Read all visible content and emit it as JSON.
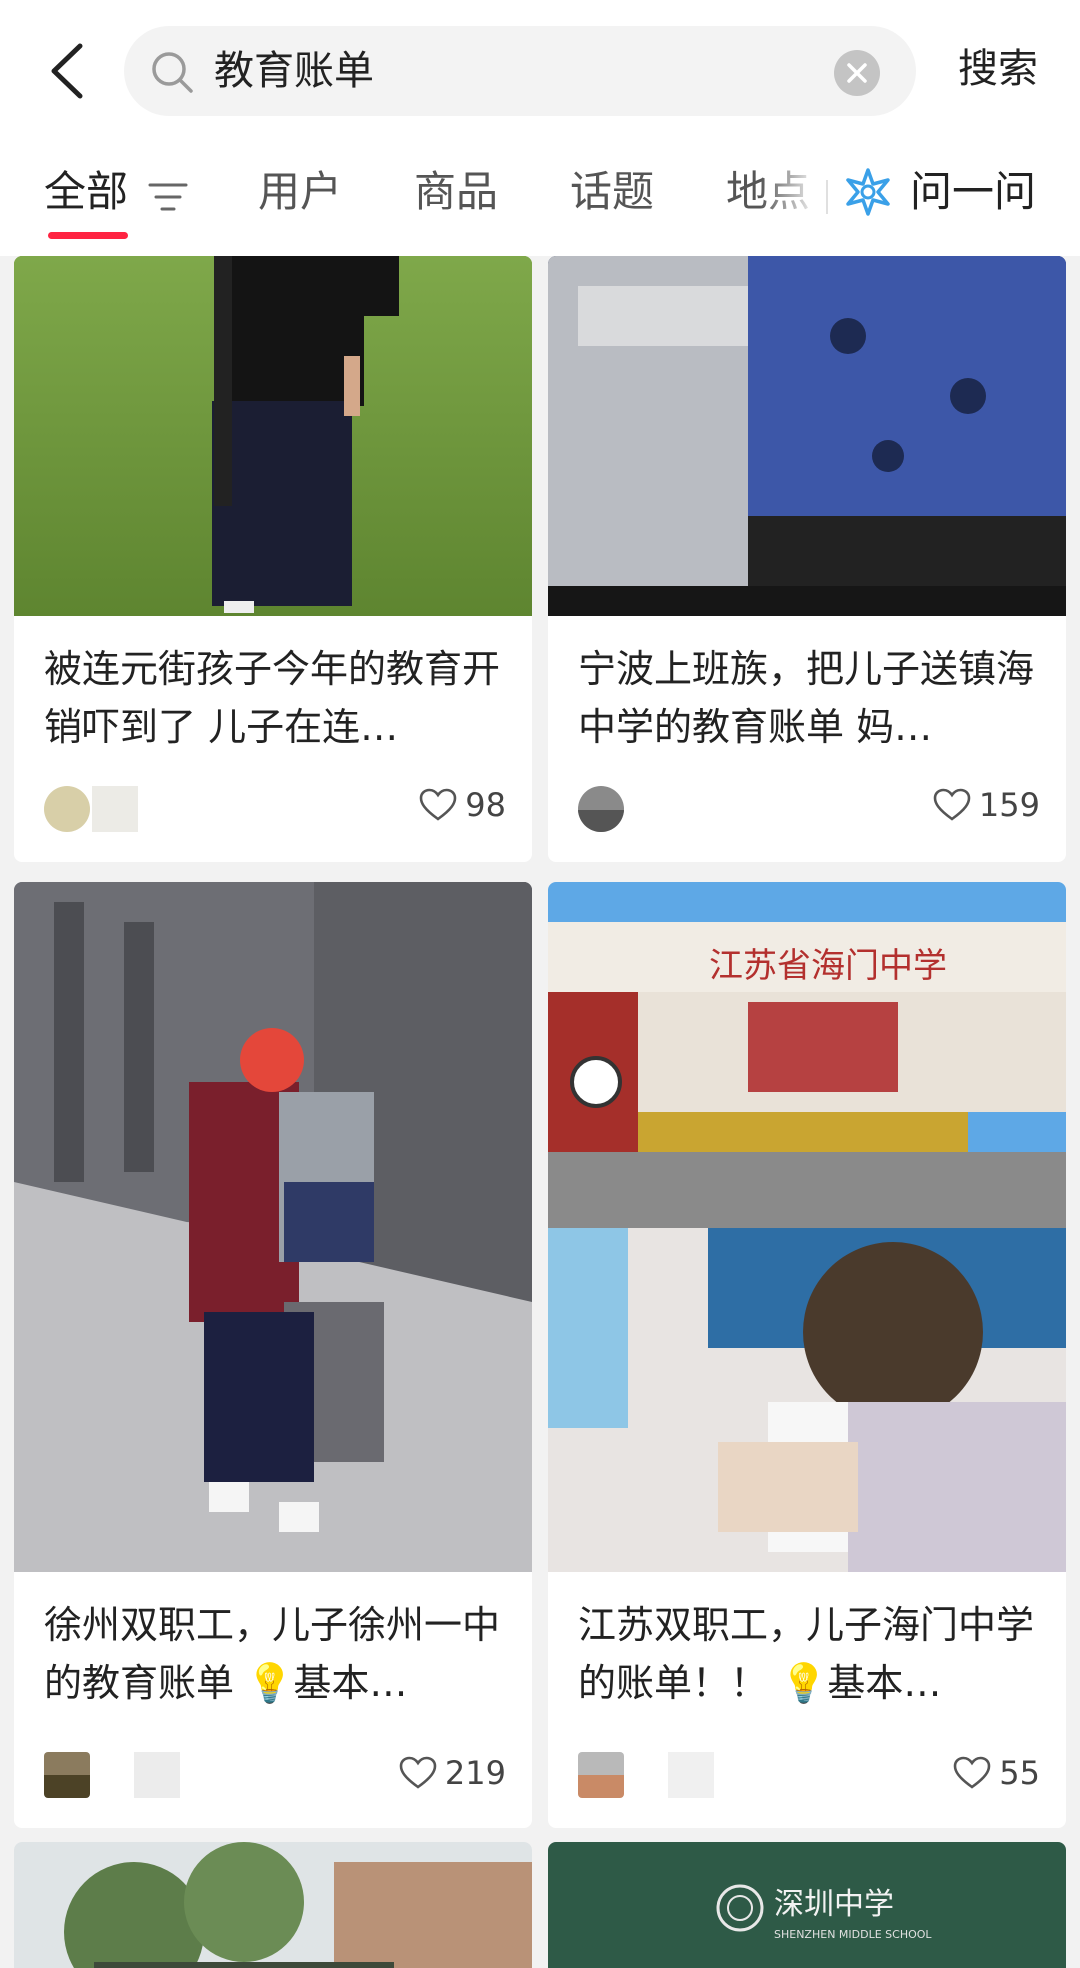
{
  "search": {
    "query": "教育账单",
    "submit_label": "搜索"
  },
  "tabs": {
    "items": [
      "全部",
      "用户",
      "商品",
      "话题",
      "地点"
    ],
    "ask_label": "问一问",
    "active": "全部"
  },
  "colors": {
    "accent": "#ff2442",
    "ask_icon": "#3aa0e8"
  },
  "feed": {
    "cards": [
      {
        "title": "被连元街孩子今年的教育开销吓到了 儿子在连…",
        "likes": "98"
      },
      {
        "title": "宁波上班族，把儿子送镇海中学的教育账单 妈…",
        "likes": "159"
      },
      {
        "title": "徐州双职工，儿子徐州一中的教育账单 💡基本…",
        "likes": "219"
      },
      {
        "title": "江苏双职工，儿子海门中学的账单！！ 💡基本…",
        "likes": "55"
      }
    ],
    "image_texts": {
      "school_gate": "江苏省海门中学",
      "shenzhen_logo": "深圳中学",
      "shenzhen_logo_en": "SHENZHEN MIDDLE SCHOOL"
    }
  }
}
